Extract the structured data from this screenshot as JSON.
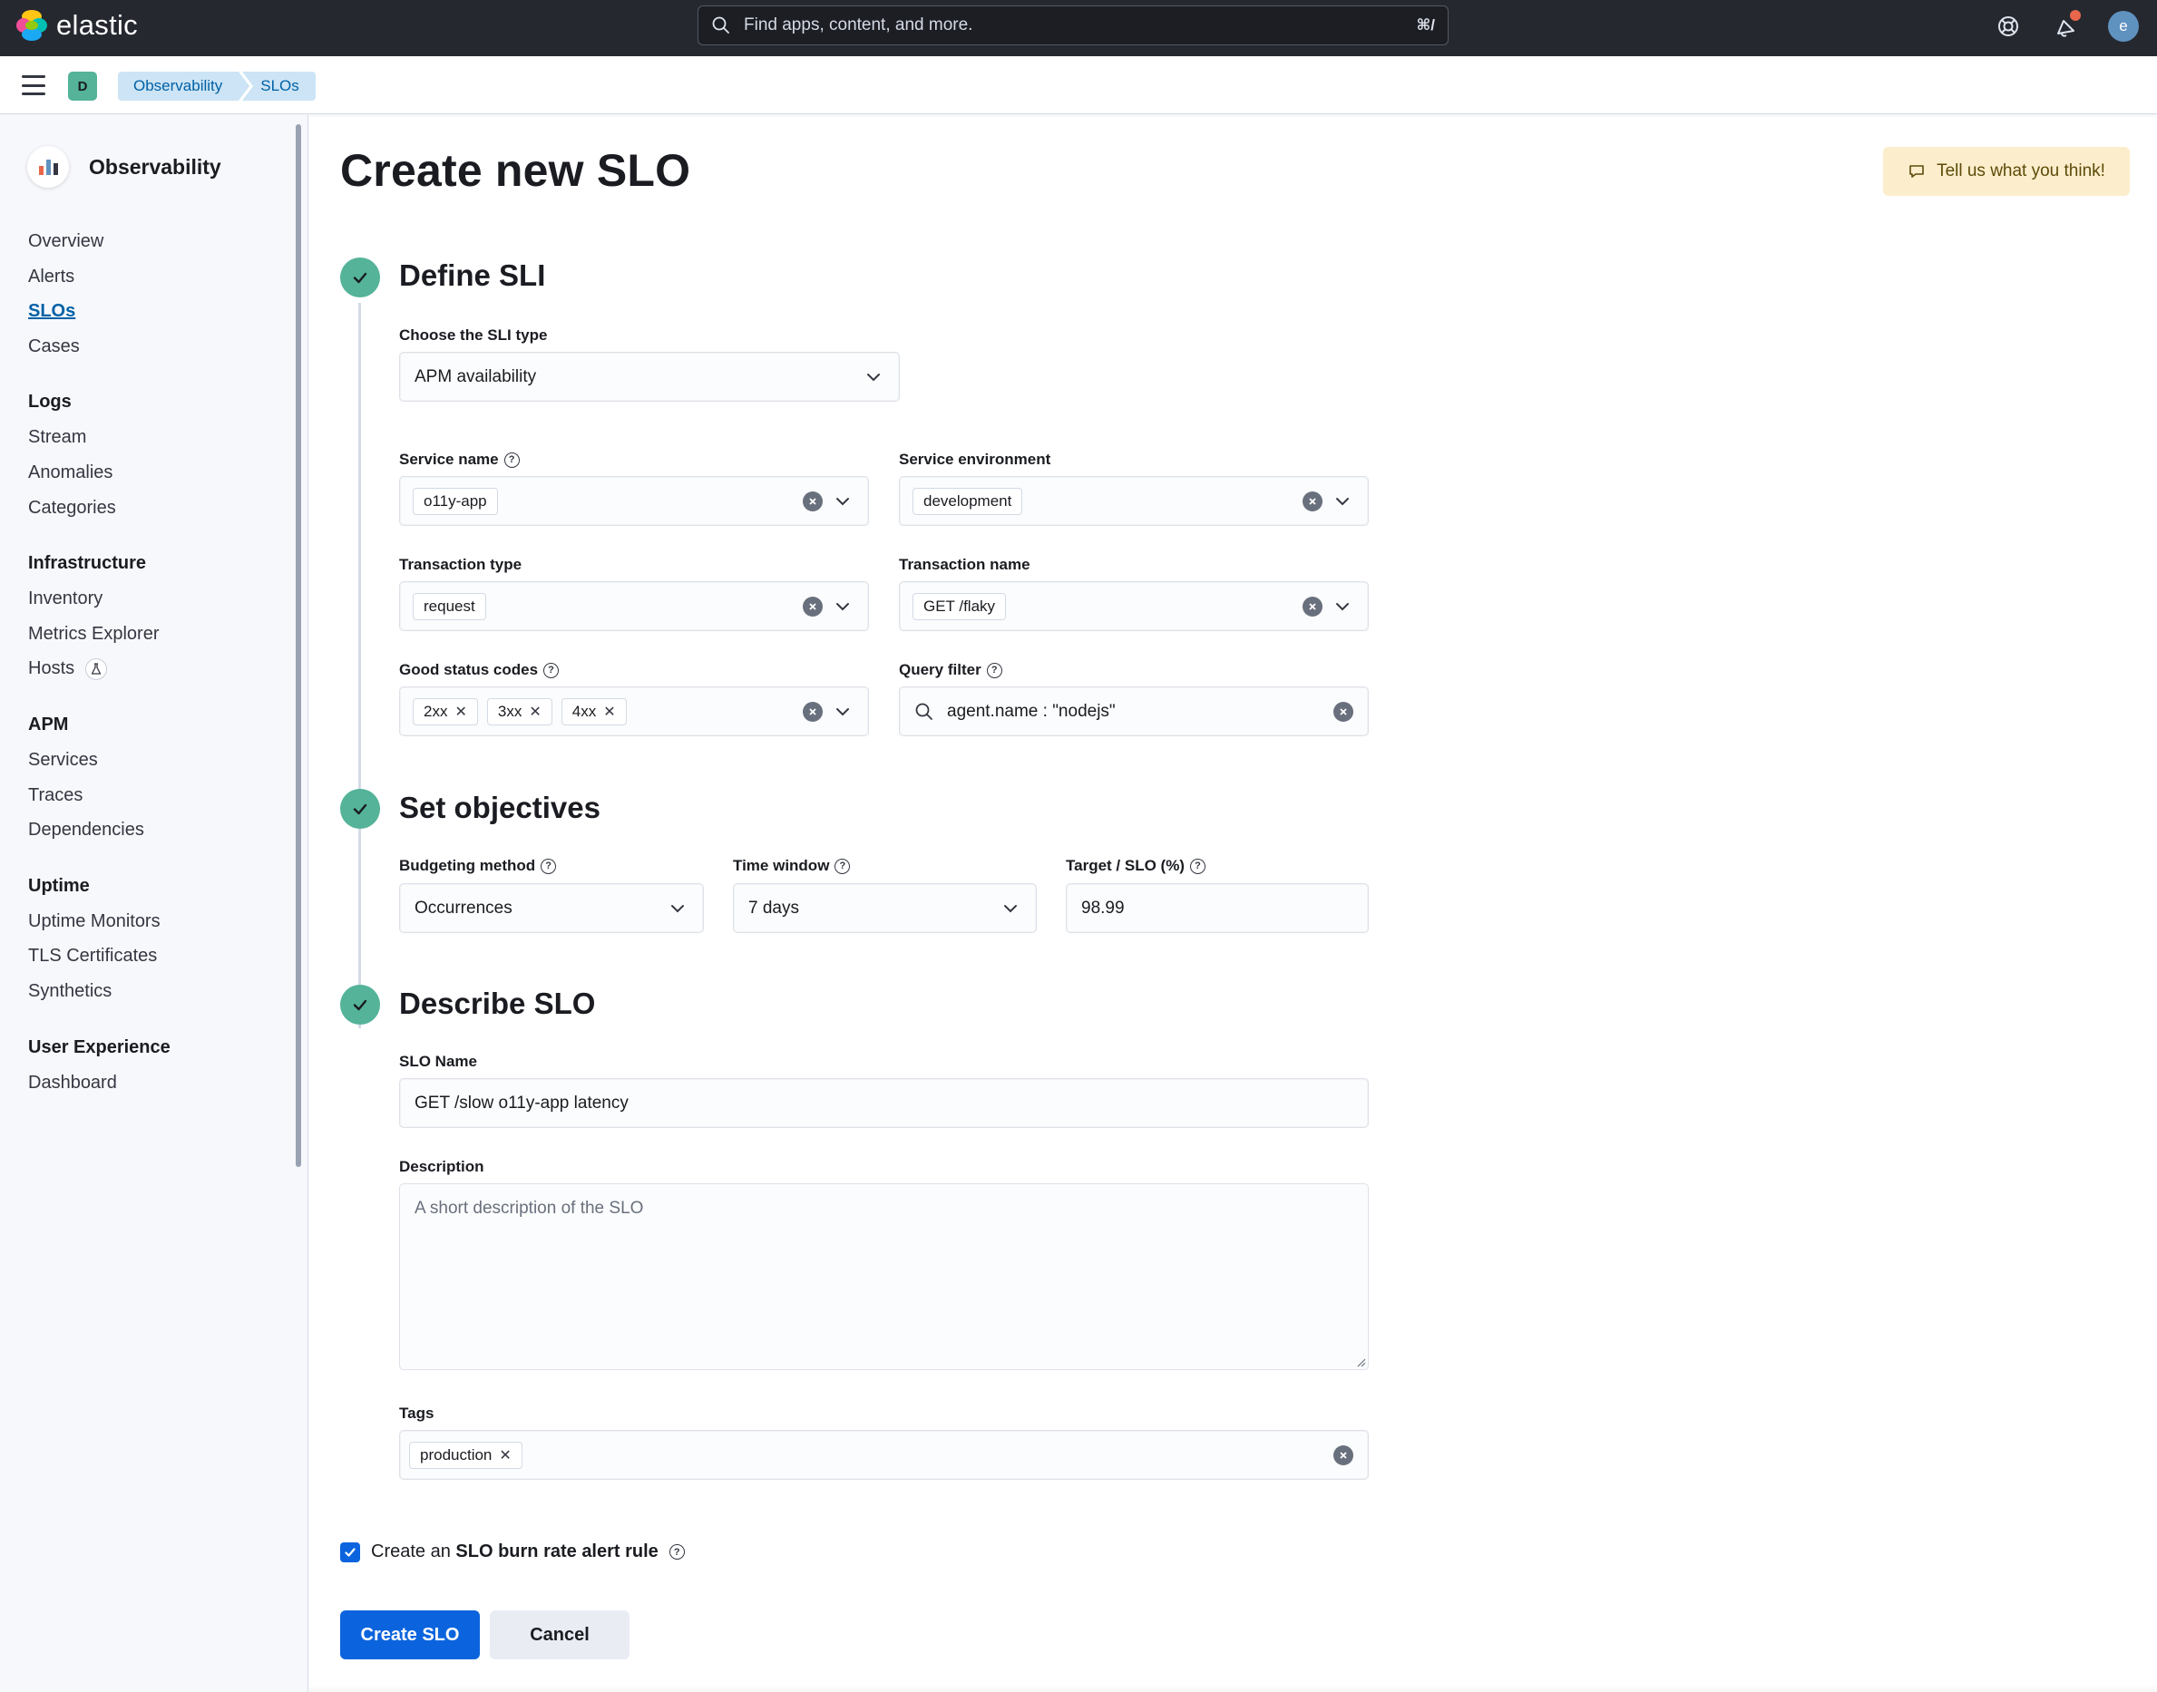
{
  "header": {
    "brand": "elastic",
    "search_placeholder": "Find apps, content, and more.",
    "search_shortcut": "⌘/",
    "avatar_initial": "e",
    "icons": [
      "help-icon",
      "newsfeed-icon",
      "user-avatar"
    ]
  },
  "breadcrumbs": {
    "space_initial": "D",
    "items": [
      "Observability",
      "SLOs"
    ]
  },
  "sidebar": {
    "title": "Observability",
    "groups": [
      {
        "title": "",
        "items": [
          "Overview",
          "Alerts",
          "SLOs",
          "Cases"
        ]
      },
      {
        "title": "Logs",
        "items": [
          "Stream",
          "Anomalies",
          "Categories"
        ]
      },
      {
        "title": "Infrastructure",
        "items": [
          "Inventory",
          "Metrics Explorer",
          "Hosts"
        ]
      },
      {
        "title": "APM",
        "items": [
          "Services",
          "Traces",
          "Dependencies"
        ]
      },
      {
        "title": "Uptime",
        "items": [
          "Uptime Monitors",
          "TLS Certificates",
          "Synthetics"
        ]
      },
      {
        "title": "User Experience",
        "items": [
          "Dashboard"
        ]
      }
    ],
    "active_item": "SLOs"
  },
  "page": {
    "title": "Create new SLO",
    "feedback_label": "Tell us what you think!"
  },
  "define_sli": {
    "title": "Define SLI",
    "sli_type_label": "Choose the SLI type",
    "sli_type_value": "APM availability",
    "service_name_label": "Service name",
    "service_name_value": "o11y-app",
    "service_env_label": "Service environment",
    "service_env_value": "development",
    "transaction_type_label": "Transaction type",
    "transaction_type_value": "request",
    "transaction_name_label": "Transaction name",
    "transaction_name_value": "GET /flaky",
    "good_status_label": "Good status codes",
    "good_status_values": [
      "2xx",
      "3xx",
      "4xx"
    ],
    "query_filter_label": "Query filter",
    "query_filter_value": "agent.name : \"nodejs\""
  },
  "objectives": {
    "title": "Set objectives",
    "budgeting_label": "Budgeting method",
    "budgeting_value": "Occurrences",
    "time_window_label": "Time window",
    "time_window_value": "7 days",
    "target_label": "Target / SLO (%)",
    "target_value": "98.99"
  },
  "describe": {
    "title": "Describe SLO",
    "name_label": "SLO Name",
    "name_value": "GET /slow o11y-app latency",
    "description_label": "Description",
    "description_placeholder": "A short description of the SLO",
    "tags_label": "Tags",
    "tags": [
      "production"
    ]
  },
  "alert_rule": {
    "prefix": "Create an",
    "bold": "SLO burn rate alert rule",
    "checked": true
  },
  "actions": {
    "create_label": "Create SLO",
    "cancel_label": "Cancel"
  },
  "colors": {
    "header_bg": "#25282f",
    "step_green": "#54b399",
    "primary": "#0b64dd",
    "breadcrumb_bg": "#cce4f5",
    "feedback_bg": "#fceecc"
  }
}
